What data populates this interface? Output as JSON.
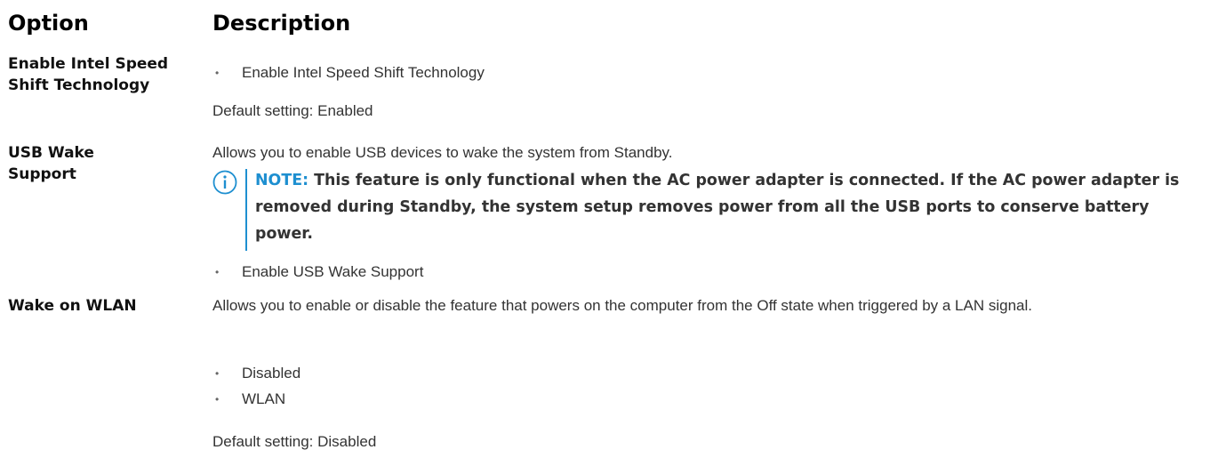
{
  "header": {
    "option": "Option",
    "description": "Description"
  },
  "rows": [
    {
      "option": "Enable Intel Speed Shift Technology",
      "bullets": [
        "Enable Intel Speed Shift Technology"
      ],
      "default": "Default setting: Enabled"
    },
    {
      "option": "USB Wake Support",
      "description": "Allows you to enable USB devices to wake the system from Standby.",
      "note": {
        "label": "NOTE:",
        "text": "This feature is only functional when the AC power adapter is connected. If the AC power adapter is removed during Standby, the system setup removes power from all the USB ports to conserve battery power.",
        "icon": "info-icon",
        "color": "#1e8fd0"
      },
      "bullets": [
        "Enable USB Wake Support"
      ]
    },
    {
      "option": "Wake on WLAN",
      "description": "Allows you to enable or disable the feature that powers on the computer from the Off state when triggered by a LAN signal.",
      "bullets": [
        "Disabled",
        "WLAN"
      ],
      "default": "Default setting: Disabled"
    }
  ]
}
